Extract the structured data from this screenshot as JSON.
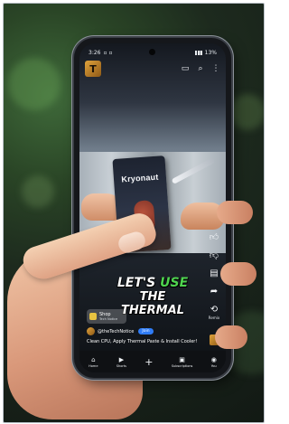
{
  "status_bar": {
    "time": "3:26",
    "battery": "13%"
  },
  "video": {
    "packet_brand": "Kryonaut",
    "headline": {
      "line1_prefix": "LET'S",
      "line1_accent": "USE",
      "line2": "THE",
      "line3": "THERMAL"
    },
    "shop": {
      "title": "Shop",
      "subtitle": "Tech Notice"
    },
    "channel": {
      "name": "@theTechNotice",
      "join_label": "Join"
    },
    "caption": "Clean CPU, Apply Thermal Paste & Install Cooler!",
    "rail": [
      {
        "icon": "thumbs-up-icon",
        "label": ""
      },
      {
        "icon": "thumbs-down-icon",
        "label": ""
      },
      {
        "icon": "comment-icon",
        "label": ""
      },
      {
        "icon": "share-icon",
        "label": ""
      },
      {
        "icon": "remix-icon",
        "label": "Remix"
      }
    ]
  },
  "bottom_nav": [
    {
      "icon": "home-icon",
      "label": "Home"
    },
    {
      "icon": "shorts-icon",
      "label": "Shorts"
    },
    {
      "icon": "create-icon",
      "label": ""
    },
    {
      "icon": "subscriptions-icon",
      "label": "Subscriptions"
    },
    {
      "icon": "you-icon",
      "label": "You"
    }
  ]
}
